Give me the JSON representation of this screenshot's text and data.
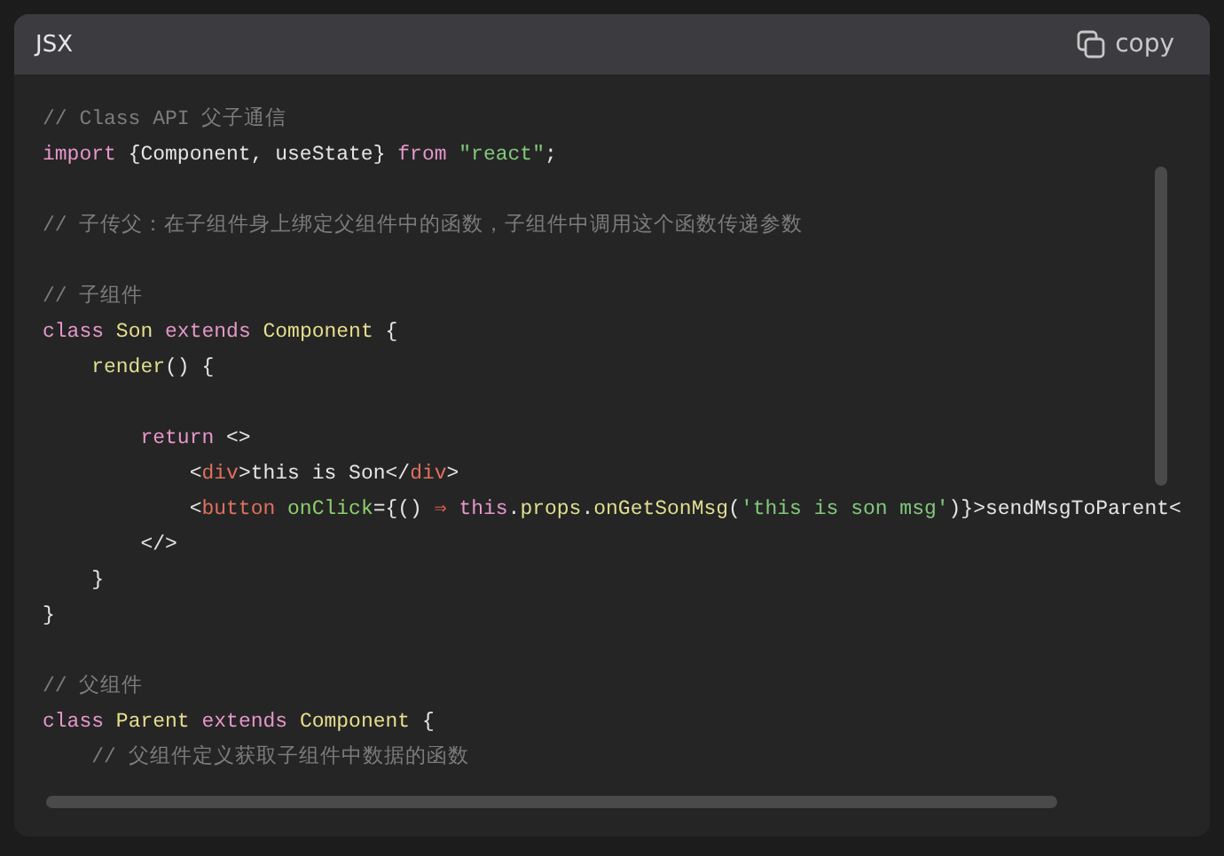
{
  "code_block": {
    "language": "JSX",
    "copy_button": {
      "label": "copy"
    },
    "lines": [
      {
        "kind": "code",
        "tokens": [
          {
            "kind": "cm",
            "text": "// Class API 父子通信"
          }
        ]
      },
      {
        "kind": "code",
        "tokens": [
          {
            "kind": "kw",
            "text": "import "
          },
          {
            "kind": "txt",
            "text": "{Component, useState} "
          },
          {
            "kind": "kw",
            "text": "from "
          },
          {
            "kind": "str",
            "text": "\"react\""
          },
          {
            "kind": "txt",
            "text": ";"
          }
        ]
      },
      {
        "kind": "blank"
      },
      {
        "kind": "code",
        "tokens": [
          {
            "kind": "cm",
            "text": "// 子传父：在子组件身上绑定父组件中的函数，子组件中调用这个函数传递参数"
          }
        ]
      },
      {
        "kind": "blank"
      },
      {
        "kind": "code",
        "tokens": [
          {
            "kind": "cm",
            "text": "// 子组件"
          }
        ]
      },
      {
        "kind": "code",
        "tokens": [
          {
            "kind": "kw",
            "text": "class "
          },
          {
            "kind": "type",
            "text": "Son "
          },
          {
            "kind": "kw",
            "text": "extends "
          },
          {
            "kind": "type",
            "text": "Component "
          },
          {
            "kind": "txt",
            "text": "{"
          }
        ]
      },
      {
        "kind": "code",
        "tokens": [
          {
            "kind": "fn",
            "text": "    render"
          },
          {
            "kind": "txt",
            "text": "() {"
          }
        ]
      },
      {
        "kind": "blank"
      },
      {
        "kind": "code",
        "tokens": [
          {
            "kind": "kw",
            "text": "        return "
          },
          {
            "kind": "txt",
            "text": "<>"
          }
        ]
      },
      {
        "kind": "code",
        "tokens": [
          {
            "kind": "txt",
            "text": "            <"
          },
          {
            "kind": "tag",
            "text": "div"
          },
          {
            "kind": "txt",
            "text": ">this is Son</"
          },
          {
            "kind": "tag",
            "text": "div"
          },
          {
            "kind": "txt",
            "text": ">"
          }
        ]
      },
      {
        "kind": "code",
        "tokens": [
          {
            "kind": "txt",
            "text": "            <"
          },
          {
            "kind": "tag",
            "text": "button "
          },
          {
            "kind": "attr",
            "text": "onClick"
          },
          {
            "kind": "txt",
            "text": "={() "
          },
          {
            "kind": "op",
            "text": "⇒ "
          },
          {
            "kind": "kw",
            "text": "this"
          },
          {
            "kind": "txt",
            "text": "."
          },
          {
            "kind": "fn",
            "text": "props"
          },
          {
            "kind": "txt",
            "text": "."
          },
          {
            "kind": "fn",
            "text": "onGetSonMsg"
          },
          {
            "kind": "txt",
            "text": "("
          },
          {
            "kind": "str",
            "text": "'this is son msg'"
          },
          {
            "kind": "txt",
            "text": ")}>sendMsgToParent<"
          }
        ]
      },
      {
        "kind": "code",
        "tokens": [
          {
            "kind": "txt",
            "text": "        </>"
          }
        ]
      },
      {
        "kind": "code",
        "tokens": [
          {
            "kind": "txt",
            "text": "    }"
          }
        ]
      },
      {
        "kind": "code",
        "tokens": [
          {
            "kind": "txt",
            "text": "}"
          }
        ]
      },
      {
        "kind": "blank"
      },
      {
        "kind": "code",
        "tokens": [
          {
            "kind": "cm",
            "text": "// 父组件"
          }
        ]
      },
      {
        "kind": "code",
        "tokens": [
          {
            "kind": "kw",
            "text": "class "
          },
          {
            "kind": "type",
            "text": "Parent "
          },
          {
            "kind": "kw",
            "text": "extends "
          },
          {
            "kind": "type",
            "text": "Component "
          },
          {
            "kind": "txt",
            "text": "{"
          }
        ]
      },
      {
        "kind": "code",
        "tokens": [
          {
            "kind": "cm",
            "text": "    // 父组件定义获取子组件中数据的函数"
          }
        ]
      }
    ]
  }
}
